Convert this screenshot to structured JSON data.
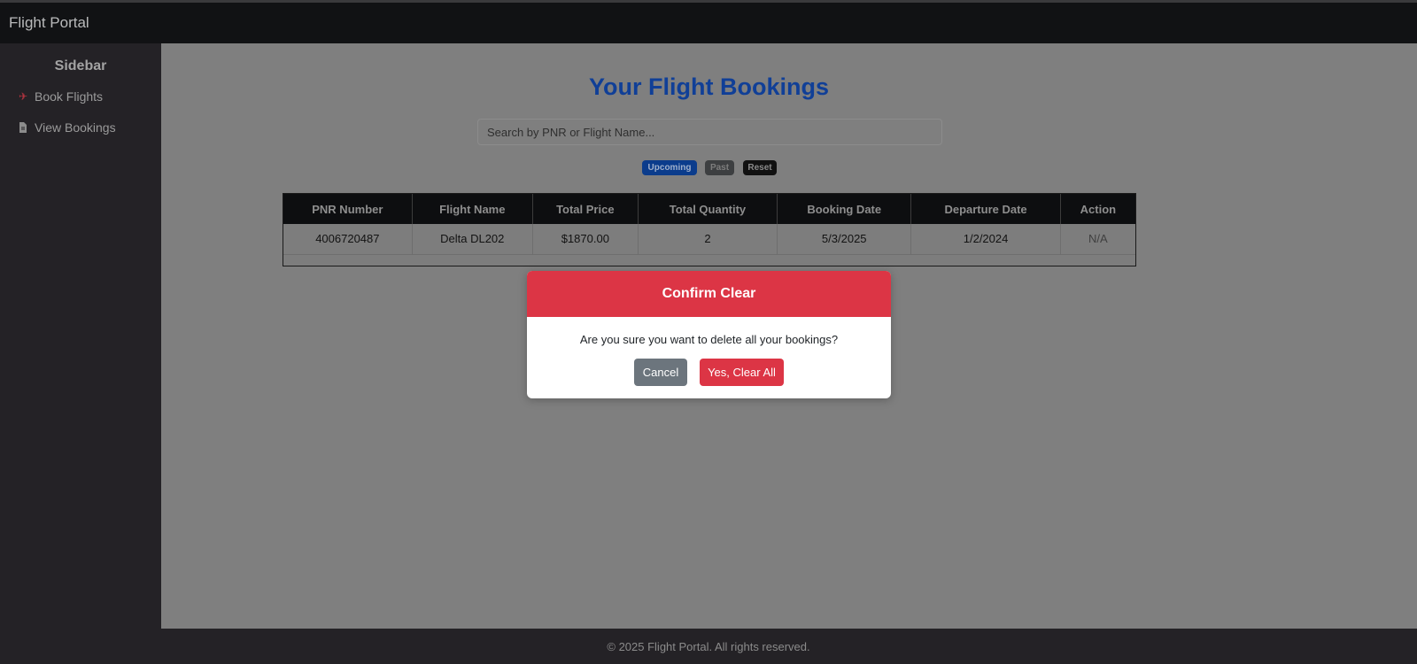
{
  "navbar": {
    "brand": "Flight Portal"
  },
  "sidebar": {
    "title": "Sidebar",
    "items": [
      {
        "label": "Book Flights",
        "icon": "plane-icon"
      },
      {
        "label": "View Bookings",
        "icon": "document-icon"
      }
    ]
  },
  "main": {
    "title": "Your Flight Bookings",
    "search": {
      "placeholder": "Search by PNR or Flight Name...",
      "value": ""
    },
    "filters": {
      "upcoming": "Upcoming",
      "past": "Past",
      "reset": "Reset"
    },
    "table": {
      "headers": [
        "PNR Number",
        "Flight Name",
        "Total Price",
        "Total Quantity",
        "Booking Date",
        "Departure Date",
        "Action"
      ],
      "rows": [
        [
          "4006720487",
          "Delta DL202",
          "$1870.00",
          "2",
          "5/3/2025",
          "1/2/2024",
          "N/A"
        ]
      ]
    }
  },
  "modal": {
    "title": "Confirm Clear",
    "message": "Are you sure you want to delete all your bookings?",
    "cancel": "Cancel",
    "confirm": "Yes, Clear All"
  },
  "footer": {
    "text": "© 2025 Flight Portal. All rights reserved."
  },
  "colors": {
    "accent": "#103f97",
    "danger": "#dc3545",
    "secondary": "#6c757d",
    "overlay": "#7f7f7f"
  }
}
